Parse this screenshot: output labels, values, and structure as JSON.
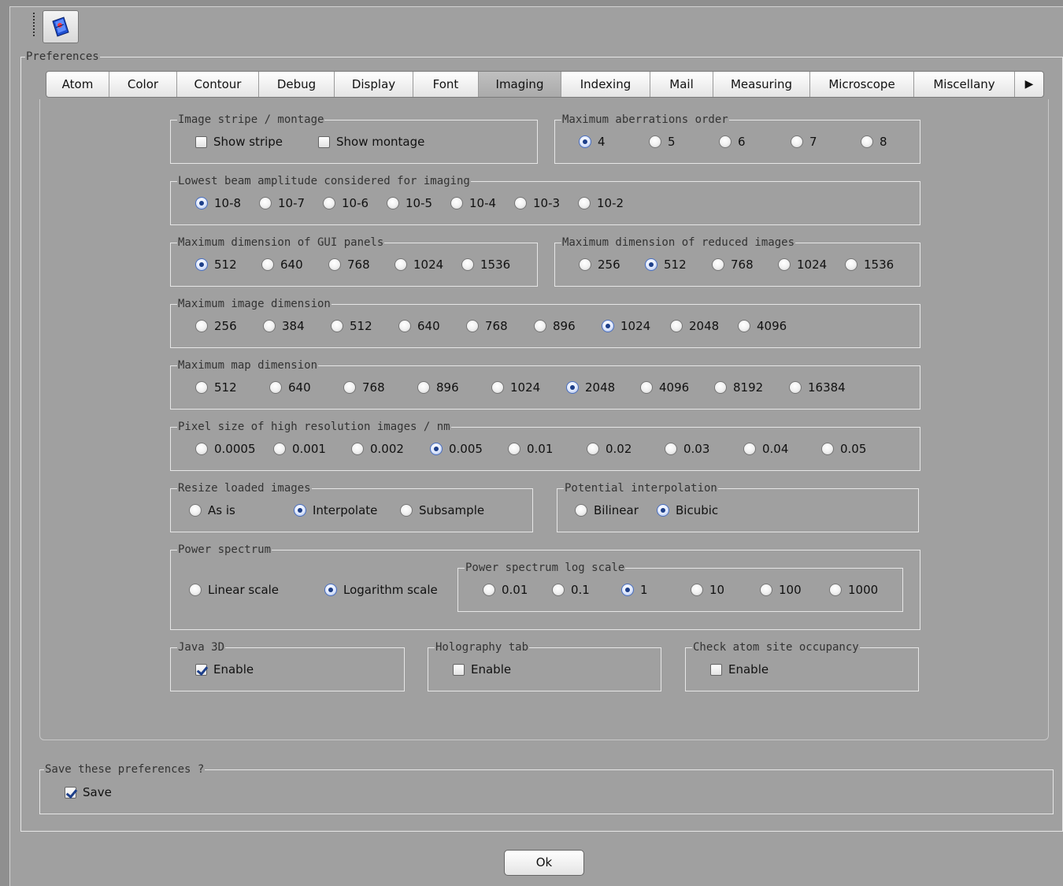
{
  "preferences_legend": "Preferences",
  "tabs": [
    "Atom",
    "Color",
    "Contour",
    "Debug",
    "Display",
    "Font",
    "Imaging",
    "Indexing",
    "Mail",
    "Measuring",
    "Microscope",
    "Miscellany"
  ],
  "selected_tab": "Imaging",
  "image_stripe": {
    "legend": "Image stripe / montage",
    "show_stripe": "Show stripe",
    "show_montage": "Show montage",
    "show_stripe_checked": false,
    "show_montage_checked": false
  },
  "aberrations": {
    "legend": "Maximum aberrations order",
    "options": [
      "4",
      "5",
      "6",
      "7",
      "8"
    ],
    "selected": "4"
  },
  "beam_amplitude": {
    "legend": "Lowest beam amplitude considered for imaging",
    "options": [
      "10-8",
      "10-7",
      "10-6",
      "10-5",
      "10-4",
      "10-3",
      "10-2"
    ],
    "selected": "10-8"
  },
  "gui_panels": {
    "legend": "Maximum dimension of GUI panels",
    "options": [
      "512",
      "640",
      "768",
      "1024",
      "1536"
    ],
    "selected": "512"
  },
  "reduced_images": {
    "legend": "Maximum dimension of reduced images",
    "options": [
      "256",
      "512",
      "768",
      "1024",
      "1536"
    ],
    "selected": "512"
  },
  "image_dimension": {
    "legend": "Maximum image dimension",
    "options": [
      "256",
      "384",
      "512",
      "640",
      "768",
      "896",
      "1024",
      "2048",
      "4096"
    ],
    "selected": "1024"
  },
  "map_dimension": {
    "legend": "Maximum map dimension",
    "options": [
      "512",
      "640",
      "768",
      "896",
      "1024",
      "2048",
      "4096",
      "8192",
      "16384"
    ],
    "selected": "2048"
  },
  "pixel_size": {
    "legend": "Pixel size of high resolution images / nm",
    "options": [
      "0.0005",
      "0.001",
      "0.002",
      "0.005",
      "0.01",
      "0.02",
      "0.03",
      "0.04",
      "0.05"
    ],
    "selected": "0.005"
  },
  "resize": {
    "legend": "Resize loaded images",
    "options": [
      "As is",
      "Interpolate",
      "Subsample"
    ],
    "selected": "Interpolate"
  },
  "interpolation": {
    "legend": "Potential interpolation",
    "options": [
      "Bilinear",
      "Bicubic"
    ],
    "selected": "Bicubic"
  },
  "power_spectrum": {
    "legend": "Power spectrum",
    "options": [
      "Linear scale",
      "Logarithm scale"
    ],
    "selected": "Logarithm scale"
  },
  "log_scale": {
    "legend": "Power spectrum log scale",
    "options": [
      "0.01",
      "0.1",
      "1",
      "10",
      "100",
      "1000"
    ],
    "selected": "1"
  },
  "java3d": {
    "legend": "Java 3D",
    "label": "Enable",
    "checked": true
  },
  "holography": {
    "legend": "Holography tab",
    "label": "Enable",
    "checked": false
  },
  "occupancy": {
    "legend": "Check atom site occupancy",
    "label": "Enable",
    "checked": false
  },
  "save": {
    "legend": "Save these preferences ?",
    "label": "Save",
    "checked": true
  },
  "ok_label": "Ok"
}
